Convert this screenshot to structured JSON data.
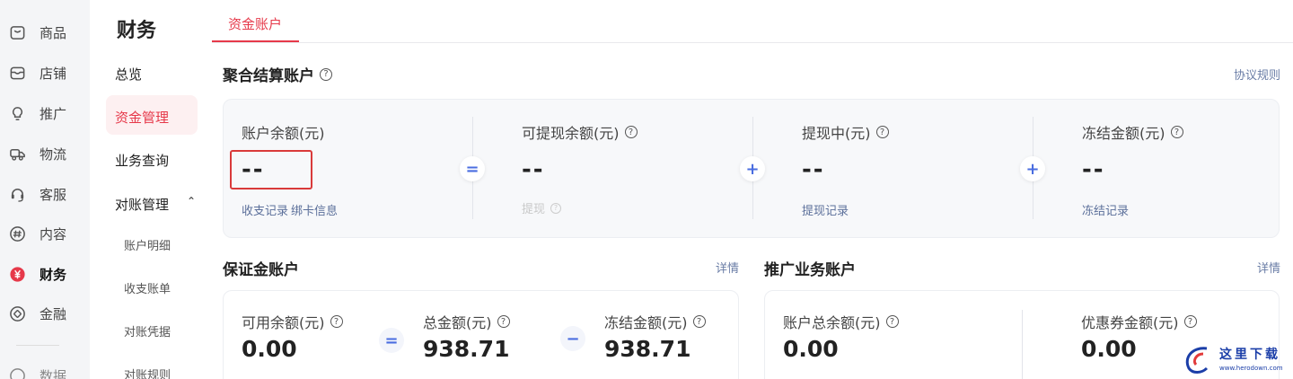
{
  "rail": {
    "items": [
      {
        "label": "商品",
        "icon": "bag-icon"
      },
      {
        "label": "店铺",
        "icon": "store-icon"
      },
      {
        "label": "推广",
        "icon": "bulb-icon"
      },
      {
        "label": "物流",
        "icon": "truck-icon"
      },
      {
        "label": "客服",
        "icon": "headset-icon"
      },
      {
        "label": "内容",
        "icon": "hash-icon"
      },
      {
        "label": "财务",
        "icon": "yuan-icon"
      },
      {
        "label": "金融",
        "icon": "finance-icon"
      },
      {
        "label": "数据",
        "icon": "data-icon"
      }
    ],
    "active_color": "#e6394a"
  },
  "subnav": {
    "title": "财务",
    "items": [
      "总览",
      "资金管理",
      "业务查询",
      "对账管理"
    ],
    "active": "资金管理",
    "recon_children": [
      "账户明细",
      "收支账单",
      "对账凭据",
      "对账规则"
    ]
  },
  "tab": {
    "label": "资金账户"
  },
  "aggregate": {
    "title": "聚合结算账户",
    "link": "协议规则",
    "columns": [
      {
        "label": "账户余额(元)",
        "value": "--",
        "links": [
          "收支记录",
          "绑卡信息"
        ]
      },
      {
        "label": "可提现余额(元)",
        "value": "--",
        "links": [
          "提现"
        ]
      },
      {
        "label": "提现中(元)",
        "value": "--",
        "links": [
          "提现记录"
        ]
      },
      {
        "label": "冻结金额(元)",
        "value": "--",
        "links": [
          "冻结记录"
        ]
      }
    ],
    "operators": [
      "=",
      "+",
      "+"
    ]
  },
  "deposit": {
    "title": "保证金账户",
    "link": "详情",
    "columns": [
      {
        "label": "可用余额(元)",
        "value": "0.00"
      },
      {
        "label": "总金额(元)",
        "value": "938.71"
      },
      {
        "label": "冻结金额(元)",
        "value": "938.71"
      }
    ],
    "operators": [
      "=",
      "−"
    ]
  },
  "promo": {
    "title": "推广业务账户",
    "link": "详情",
    "columns": [
      {
        "label": "账户总余额(元)",
        "value": "0.00"
      },
      {
        "label": "优惠券金额(元)",
        "value": "0.00"
      }
    ]
  },
  "watermark": {
    "text": "这里下载",
    "sub": "www.herodown.com"
  }
}
